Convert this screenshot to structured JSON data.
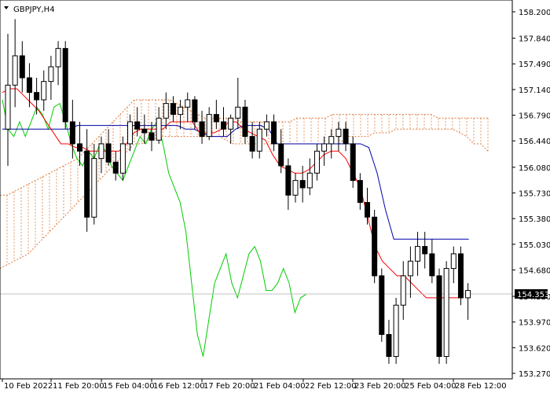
{
  "symbol_title": "GBPJPY,H4",
  "chart_data": {
    "type": "candlestick",
    "title": "GBPJPY,H4",
    "ylim": [
      153.27,
      158.37
    ],
    "y_ticks": [
      "158.200",
      "157.840",
      "157.490",
      "157.140",
      "156.790",
      "156.440",
      "156.080",
      "155.730",
      "155.380",
      "155.030",
      "154.680",
      "154.320",
      "153.970",
      "153.620",
      "153.270"
    ],
    "x_ticks": [
      "10 Feb 2022",
      "11 Feb 20:00",
      "15 Feb 04:00",
      "16 Feb 12:00",
      "17 Feb 20:00",
      "21 Feb 04:00",
      "22 Feb 12:00",
      "23 Feb 20:00",
      "25 Feb 04:00",
      "28 Feb 12:00"
    ],
    "current_price": "154.353",
    "grid": false,
    "colors": {
      "bull_candle": "#ffffff",
      "bear_candle": "#000000",
      "tenkan": "#ff0000",
      "kijun": "#0000aa",
      "chikou": "#00cc00",
      "cloud": "#e07a3a",
      "current_line": "#c0c0c0",
      "current_label_bg": "#000000"
    },
    "candles": [
      [
        156.6,
        157.9,
        156.1,
        157.2
      ],
      [
        157.2,
        158.1,
        156.9,
        157.6
      ],
      [
        157.6,
        157.8,
        157.1,
        157.3
      ],
      [
        157.3,
        157.5,
        156.9,
        157.1
      ],
      [
        157.1,
        157.3,
        156.8,
        157.0
      ],
      [
        157.0,
        157.4,
        156.85,
        157.25
      ],
      [
        157.25,
        157.6,
        157.0,
        157.45
      ],
      [
        157.45,
        157.8,
        157.2,
        157.7
      ],
      [
        157.7,
        157.8,
        156.6,
        156.7
      ],
      [
        156.7,
        157.0,
        156.2,
        156.4
      ],
      [
        156.4,
        156.7,
        156.1,
        156.3
      ],
      [
        156.3,
        156.6,
        155.2,
        155.4
      ],
      [
        155.4,
        156.4,
        155.3,
        156.2
      ],
      [
        156.2,
        156.5,
        156.0,
        156.4
      ],
      [
        156.4,
        156.6,
        156.1,
        156.15
      ],
      [
        156.15,
        156.3,
        155.9,
        156.0
      ],
      [
        156.0,
        156.5,
        155.9,
        156.4
      ],
      [
        156.4,
        156.8,
        156.3,
        156.7
      ],
      [
        156.7,
        156.9,
        156.5,
        156.6
      ],
      [
        156.6,
        156.8,
        156.4,
        156.55
      ],
      [
        156.55,
        156.7,
        156.3,
        156.45
      ],
      [
        156.45,
        156.9,
        156.4,
        156.75
      ],
      [
        156.75,
        157.1,
        156.6,
        156.95
      ],
      [
        156.95,
        157.05,
        156.7,
        156.8
      ],
      [
        156.8,
        157.0,
        156.6,
        156.9
      ],
      [
        156.9,
        157.1,
        156.7,
        157.0
      ],
      [
        157.0,
        157.05,
        156.6,
        156.7
      ],
      [
        156.7,
        156.85,
        156.4,
        156.5
      ],
      [
        156.5,
        156.9,
        156.45,
        156.8
      ],
      [
        156.8,
        157.0,
        156.6,
        156.7
      ],
      [
        156.7,
        156.9,
        156.5,
        156.6
      ],
      [
        156.6,
        156.8,
        156.4,
        156.75
      ],
      [
        156.75,
        157.3,
        156.6,
        156.9
      ],
      [
        156.9,
        157.0,
        156.4,
        156.5
      ],
      [
        156.5,
        156.7,
        156.2,
        156.3
      ],
      [
        156.3,
        156.7,
        156.2,
        156.6
      ],
      [
        156.6,
        156.8,
        156.5,
        156.7
      ],
      [
        156.7,
        156.8,
        156.3,
        156.4
      ],
      [
        156.4,
        156.6,
        156.0,
        156.1
      ],
      [
        156.1,
        156.2,
        155.5,
        155.7
      ],
      [
        155.7,
        156.0,
        155.6,
        155.9
      ],
      [
        155.9,
        156.1,
        155.6,
        155.8
      ],
      [
        155.8,
        156.2,
        155.7,
        156.0
      ],
      [
        156.0,
        156.4,
        155.9,
        156.3
      ],
      [
        156.3,
        156.5,
        156.1,
        156.4
      ],
      [
        156.4,
        156.6,
        156.2,
        156.5
      ],
      [
        156.5,
        156.7,
        156.3,
        156.6
      ],
      [
        156.6,
        156.7,
        156.3,
        156.4
      ],
      [
        156.4,
        156.5,
        155.8,
        155.9
      ],
      [
        155.9,
        156.0,
        155.5,
        155.6
      ],
      [
        155.6,
        155.8,
        155.3,
        155.4
      ],
      [
        155.4,
        155.5,
        154.5,
        154.6
      ],
      [
        154.6,
        154.7,
        153.7,
        153.8
      ],
      [
        153.8,
        154.0,
        153.4,
        153.5
      ],
      [
        153.5,
        154.3,
        153.4,
        154.2
      ],
      [
        154.2,
        154.8,
        154.0,
        154.6
      ],
      [
        154.6,
        155.0,
        154.3,
        154.8
      ],
      [
        154.8,
        155.2,
        154.6,
        155.0
      ],
      [
        155.0,
        155.2,
        154.7,
        154.9
      ],
      [
        154.9,
        155.1,
        154.5,
        154.6
      ],
      [
        154.6,
        154.7,
        153.4,
        153.5
      ],
      [
        153.5,
        154.8,
        153.4,
        154.7
      ],
      [
        154.7,
        155.0,
        154.5,
        154.9
      ],
      [
        154.9,
        155.0,
        154.2,
        154.3
      ],
      [
        154.3,
        154.5,
        154.0,
        154.4
      ]
    ],
    "tenkan": [
      157.1,
      157.15,
      157.15,
      157.05,
      156.95,
      156.85,
      156.7,
      156.55,
      156.4,
      156.4,
      156.35,
      156.35,
      156.3,
      156.3,
      156.3,
      156.3,
      156.3,
      156.4,
      156.55,
      156.6,
      156.6,
      156.6,
      156.6,
      156.7,
      156.7,
      156.7,
      156.7,
      156.55,
      156.55,
      156.55,
      156.6,
      156.7,
      156.7,
      156.6,
      156.55,
      156.5,
      156.45,
      156.25,
      156.1,
      156.05,
      156.0,
      156.0,
      156.05,
      156.15,
      156.25,
      156.3,
      156.3,
      156.2,
      156.0,
      155.8,
      155.4,
      155.0,
      154.8,
      154.7,
      154.6,
      154.6,
      154.5,
      154.4,
      154.3,
      154.3,
      154.3,
      154.3,
      154.3,
      154.3
    ],
    "kijun": [
      156.6,
      156.6,
      156.6,
      156.6,
      156.6,
      156.6,
      156.6,
      156.6,
      156.6,
      156.65,
      156.65,
      156.65,
      156.65,
      156.65,
      156.65,
      156.65,
      156.65,
      156.65,
      156.65,
      156.65,
      156.65,
      156.65,
      156.6,
      156.6,
      156.55,
      156.5,
      156.5,
      156.5,
      156.6,
      156.65,
      156.65,
      156.65,
      156.6,
      156.4,
      156.4,
      156.4,
      156.4,
      156.4,
      156.4,
      156.4,
      156.4,
      156.4,
      156.4,
      156.4,
      156.35,
      156.0,
      155.5,
      155.1,
      155.1,
      155.1,
      155.1,
      155.1,
      155.1,
      155.1,
      155.1,
      155.1,
      155.1
    ]
  }
}
